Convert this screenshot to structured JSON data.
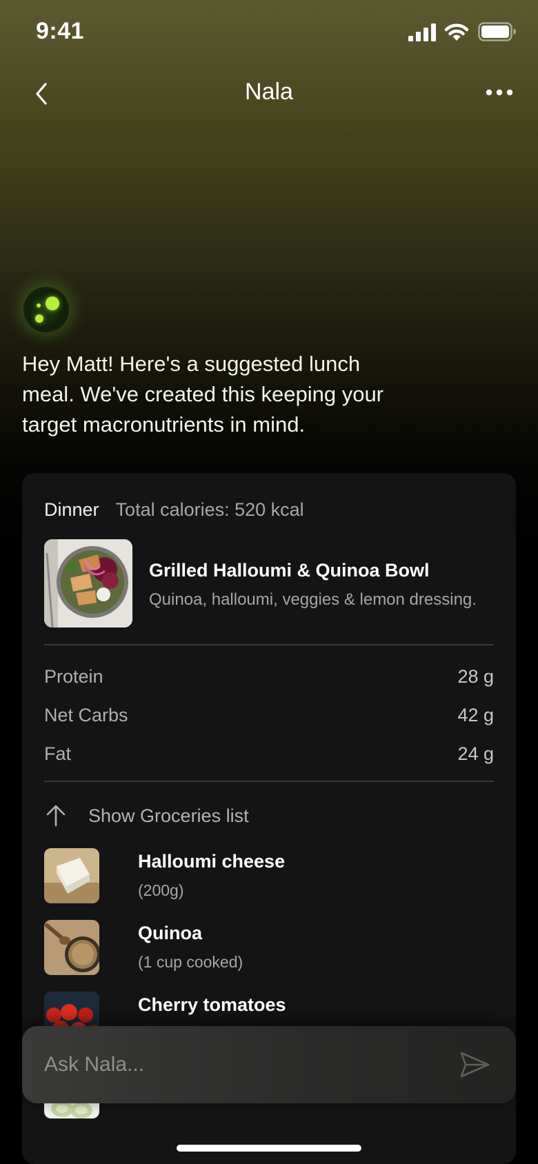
{
  "status_bar": {
    "time": "9:41"
  },
  "nav": {
    "title": "Nala"
  },
  "assistant": {
    "message": "Hey Matt! Here's a suggested lunch meal. We've created this keeping your target macronutrients in mind."
  },
  "meal": {
    "type": "Dinner",
    "calories": "Total calories: 520 kcal",
    "title": "Grilled Halloumi & Quinoa Bowl",
    "description": "Quinoa, halloumi, veggies & lemon dressing.",
    "macros": [
      {
        "label": "Protein",
        "value": "28 g"
      },
      {
        "label": "Net Carbs",
        "value": "42 g"
      },
      {
        "label": "Fat",
        "value": "24 g"
      }
    ],
    "groceries_toggle": "Show Groceries list",
    "groceries": [
      {
        "name": "Halloumi cheese",
        "qty": "(200g)"
      },
      {
        "name": "Quinoa",
        "qty": "(1 cup cooked)"
      },
      {
        "name": "Cherry tomatoes",
        "qty": ""
      }
    ]
  },
  "ask": {
    "placeholder": "Ask Nala..."
  },
  "colors": {
    "accent": "#b5f03a",
    "card": "#141414",
    "background": "#000000"
  }
}
